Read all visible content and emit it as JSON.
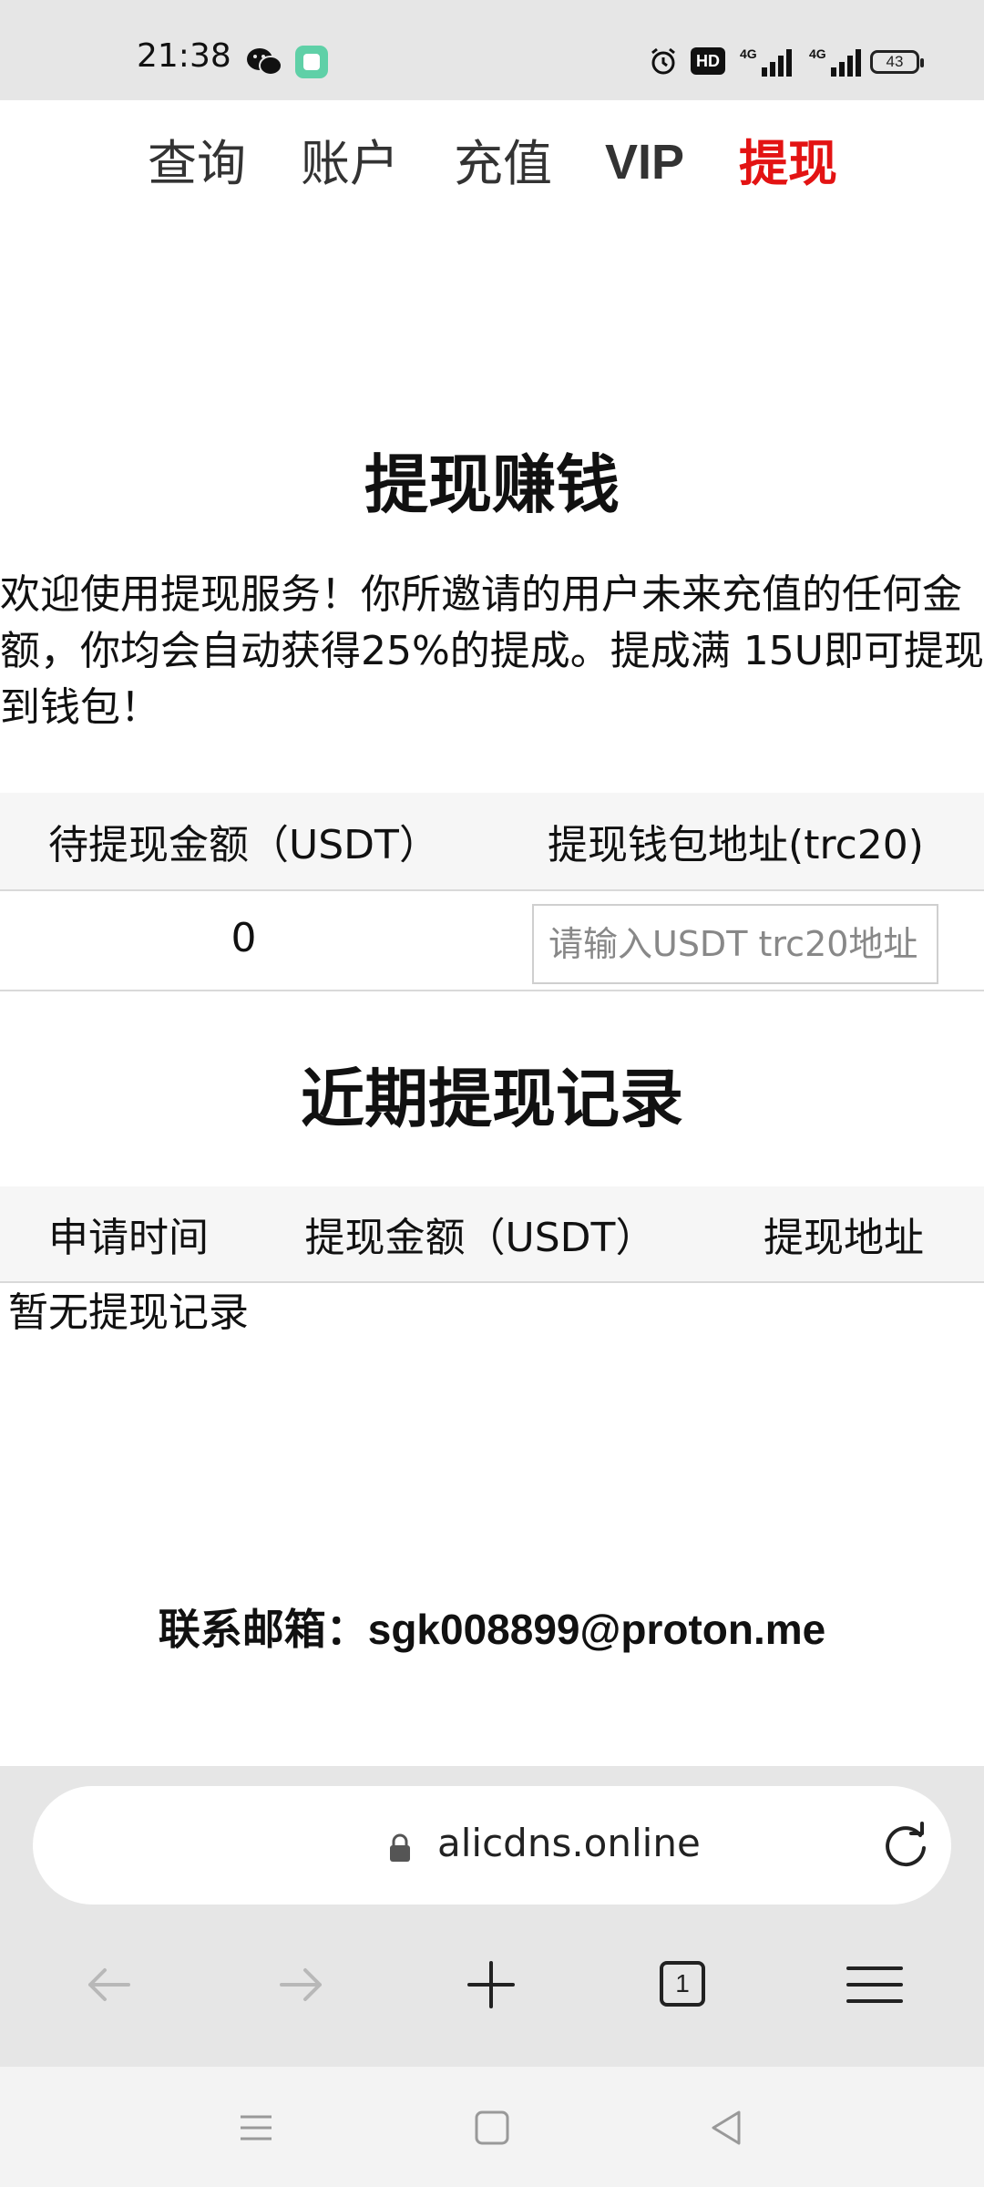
{
  "status_bar": {
    "time": "21:38",
    "battery_level": "43",
    "hd_label": "HD",
    "icons": [
      "wechat-icon",
      "app-icon",
      "alarm-icon",
      "hd-icon",
      "signal-4g-icon",
      "signal-4g-icon",
      "battery-icon"
    ]
  },
  "nav": {
    "items": [
      {
        "label": "查询"
      },
      {
        "label": "账户"
      },
      {
        "label": "充值"
      },
      {
        "label": "VIP"
      },
      {
        "label": "提现"
      }
    ],
    "active_index": 4,
    "active_color": "#e31313"
  },
  "withdraw": {
    "title": "提现赚钱",
    "intro": "欢迎使用提现服务！你所邀请的用户未来充值的任何金额，你均会自动获得25%的提成。提成满 15U即可提现到钱包！",
    "col_amount": "待提现金额（USDT）",
    "col_address": "提现钱包地址(trc20)",
    "pending_amount": "0",
    "address_placeholder": "请输入USDT trc20地址"
  },
  "records": {
    "title": "近期提现记录",
    "columns": [
      "申请时间",
      "提现金额（USDT）",
      "提现地址"
    ],
    "empty_text": "暂无提现记录"
  },
  "contact": {
    "label": "联系邮箱：",
    "email": "sgk008899@proton.me"
  },
  "browser": {
    "url": "alicdns.online",
    "tab_count": "1",
    "icons": [
      "lock-icon",
      "reload-icon",
      "back-arrow-icon",
      "forward-arrow-icon",
      "plus-icon",
      "tabs-icon",
      "menu-icon"
    ]
  },
  "system_nav": {
    "icons": [
      "menu-lines-icon",
      "home-square-icon",
      "back-triangle-icon"
    ]
  }
}
